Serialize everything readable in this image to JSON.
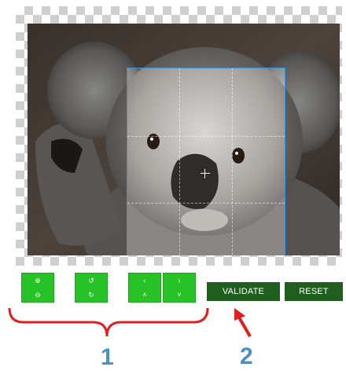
{
  "editor": {
    "image_alt": "koala photo",
    "crop_active": true
  },
  "toolbar": {
    "zoom_in_icon": "⊕",
    "zoom_out_icon": "⊖",
    "rotate_left_icon": "↺",
    "rotate_right_icon": "↻",
    "move_left_icon": "‹",
    "move_up_icon": "˄",
    "move_right_icon": "›",
    "move_down_icon": "˅",
    "button_color": "#26c226"
  },
  "actions": {
    "validate_label": "VALIDATE",
    "reset_label": "RESET",
    "button_color": "#1e5e1e"
  },
  "annotations": {
    "label_1": "1",
    "label_2": "2",
    "bracket_color": "#e02020",
    "number_color": "#4a90c8"
  }
}
